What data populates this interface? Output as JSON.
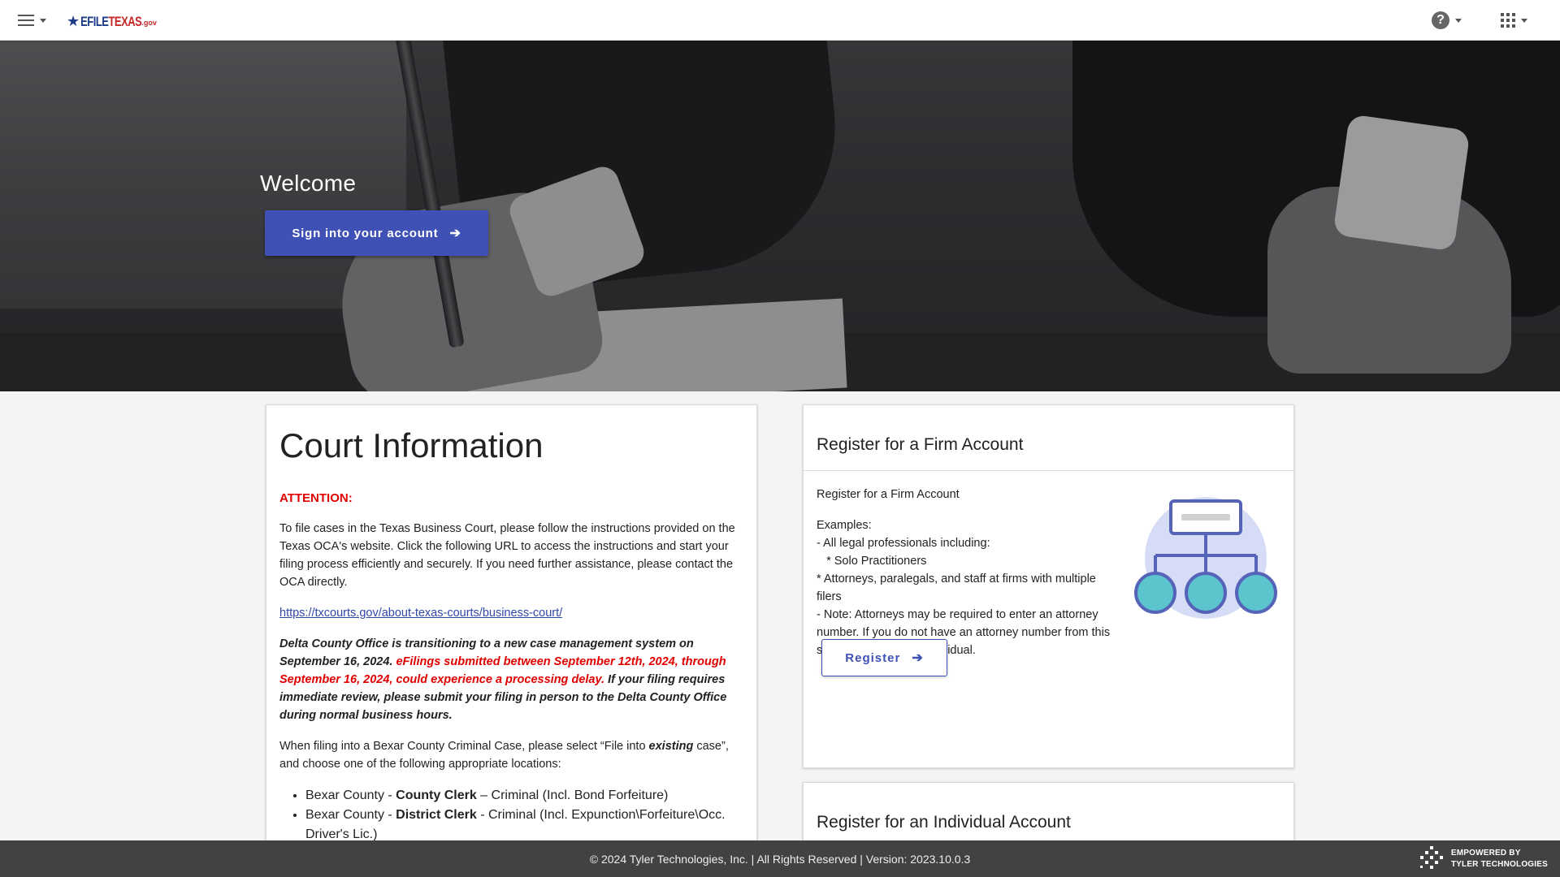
{
  "topbar": {
    "logo_efile": "EFILE",
    "logo_texas": "TEXAS",
    "logo_gov": ".gov"
  },
  "hero": {
    "welcome": "Welcome",
    "signin_label": "Sign into your account"
  },
  "court_info": {
    "title": "Court Information",
    "attention": "ATTENTION:",
    "paragraph1": "To file cases in the Texas Business Court, please follow the instructions provided on the Texas OCA's website. Click the following URL to access the instructions and start your filing process efficiently and securely. If you need further assistance, please contact the OCA directly.",
    "url": "https://txcourts.gov/about-texas-courts/business-court/",
    "notice_part1": "Delta County Office is transitioning to a new case management system on September 16, 2024. ",
    "notice_red": "eFilings submitted between September 12th, 2024, through September 16, 2024, could experience a processing delay.",
    "notice_part2": " If your filing requires immediate review, please submit your filing in person to the Delta County Office during normal business hours.",
    "bexar_intro_1": "When filing into a Bexar County Criminal Case, please select “File into ",
    "bexar_intro_em": "existing",
    "bexar_intro_2": " case”, and choose one of the following appropriate locations:",
    "locations": [
      {
        "prefix": "Bexar County - ",
        "clerk": "County Clerk",
        "suffix": " – Criminal (Incl. Bond Forfeiture)"
      },
      {
        "prefix": "Bexar County - ",
        "clerk": "District Clerk",
        "suffix": " - Criminal (Incl. Expunction\\Forfeiture\\Occ. Driver's Lic.)"
      }
    ]
  },
  "firm_account": {
    "title": "Register for a Firm Account",
    "lines": [
      "Register for a Firm Account",
      "",
      "Examples:",
      "- All legal professionals including:",
      "   * Solo Practitioners",
      "   * Attorneys, paralegals, and staff at firms with multiple filers",
      "- Note: Attorneys may be required to enter an attorney number. If you do not have an attorney number from this state, register as an individual."
    ],
    "register_label": "Register",
    "icon": "org-chart-icon"
  },
  "individual_account": {
    "title": "Register for an Individual Account"
  },
  "footer": {
    "copyright": "© 2024 Tyler Technologies, Inc. | All Rights Reserved | Version: 2023.10.0.3",
    "tyler_line1": "EMPOWERED BY",
    "tyler_line2": "TYLER TECHNOLOGIES"
  },
  "colors": {
    "primary": "#3f51b5",
    "attention_red": "#e00000",
    "footer_bg": "#424242"
  }
}
